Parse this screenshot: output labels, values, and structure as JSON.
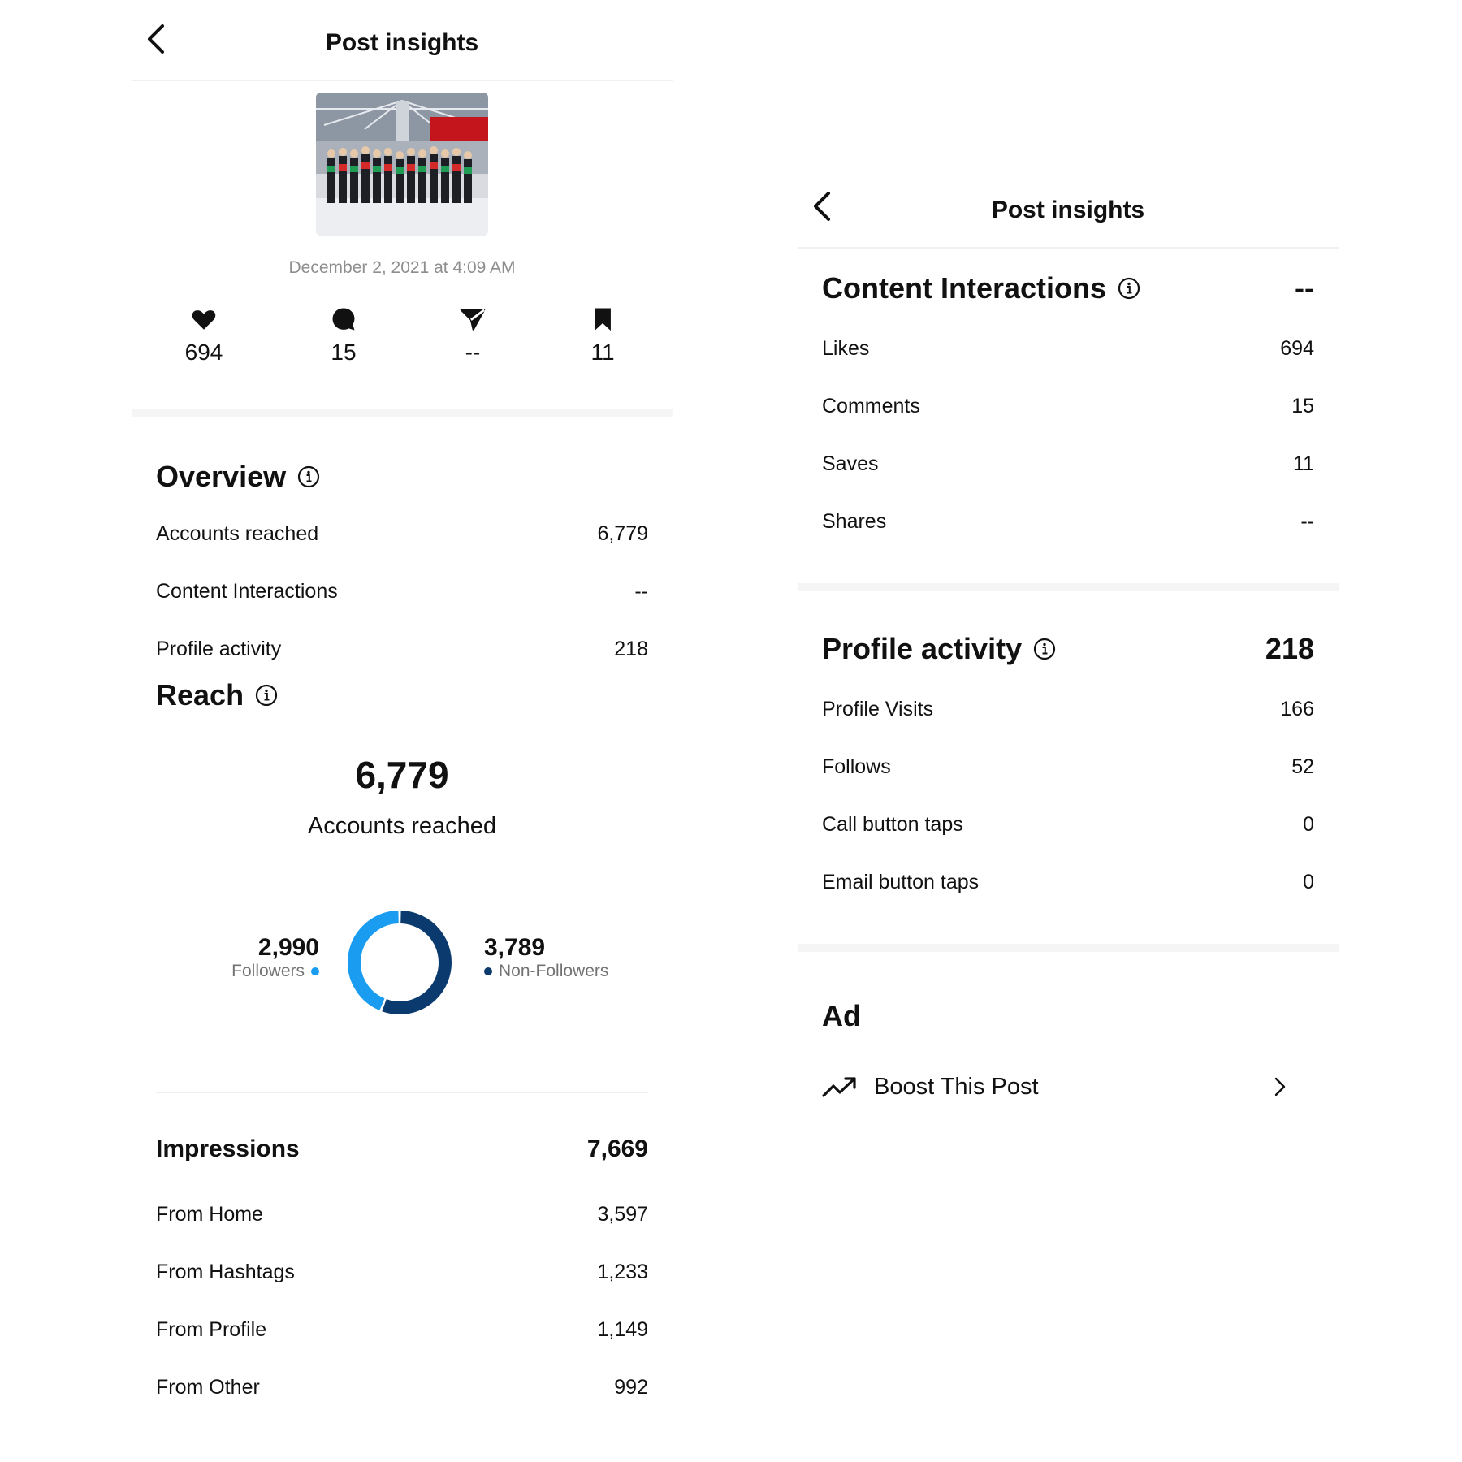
{
  "left_panel": {
    "header": {
      "title": "Post insights"
    },
    "post": {
      "date": "December 2, 2021 at 4:09 AM"
    },
    "stats": {
      "likes": "694",
      "comments": "15",
      "shares": "--",
      "saves": "11"
    },
    "overview": {
      "title": "Overview",
      "rows": [
        {
          "label": "Accounts reached",
          "value": "6,779"
        },
        {
          "label": "Content Interactions",
          "value": "--"
        },
        {
          "label": "Profile activity",
          "value": "218"
        }
      ]
    },
    "reach": {
      "title": "Reach",
      "total": "6,779",
      "total_label": "Accounts reached",
      "followers": {
        "value": "2,990",
        "label": "Followers",
        "count": 2990,
        "color": "#1a9cf0"
      },
      "non_followers": {
        "value": "3,789",
        "label": "Non-Followers",
        "count": 3789,
        "color": "#0b3a6e"
      }
    },
    "impressions": {
      "title": "Impressions",
      "total": "7,669",
      "rows": [
        {
          "label": "From Home",
          "value": "3,597"
        },
        {
          "label": "From Hashtags",
          "value": "1,233"
        },
        {
          "label": "From Profile",
          "value": "1,149"
        },
        {
          "label": "From Other",
          "value": "992"
        }
      ]
    }
  },
  "right_panel": {
    "header": {
      "title": "Post insights"
    },
    "content_interactions": {
      "title": "Content Interactions",
      "total": "--",
      "rows": [
        {
          "label": "Likes",
          "value": "694"
        },
        {
          "label": "Comments",
          "value": "15"
        },
        {
          "label": "Saves",
          "value": "11"
        },
        {
          "label": "Shares",
          "value": "--"
        }
      ]
    },
    "profile_activity": {
      "title": "Profile activity",
      "total": "218",
      "rows": [
        {
          "label": "Profile Visits",
          "value": "166"
        },
        {
          "label": "Follows",
          "value": "52"
        },
        {
          "label": "Call button taps",
          "value": "0"
        },
        {
          "label": "Email button taps",
          "value": "0"
        }
      ]
    },
    "ad": {
      "title": "Ad",
      "boost_label": "Boost This Post"
    }
  }
}
